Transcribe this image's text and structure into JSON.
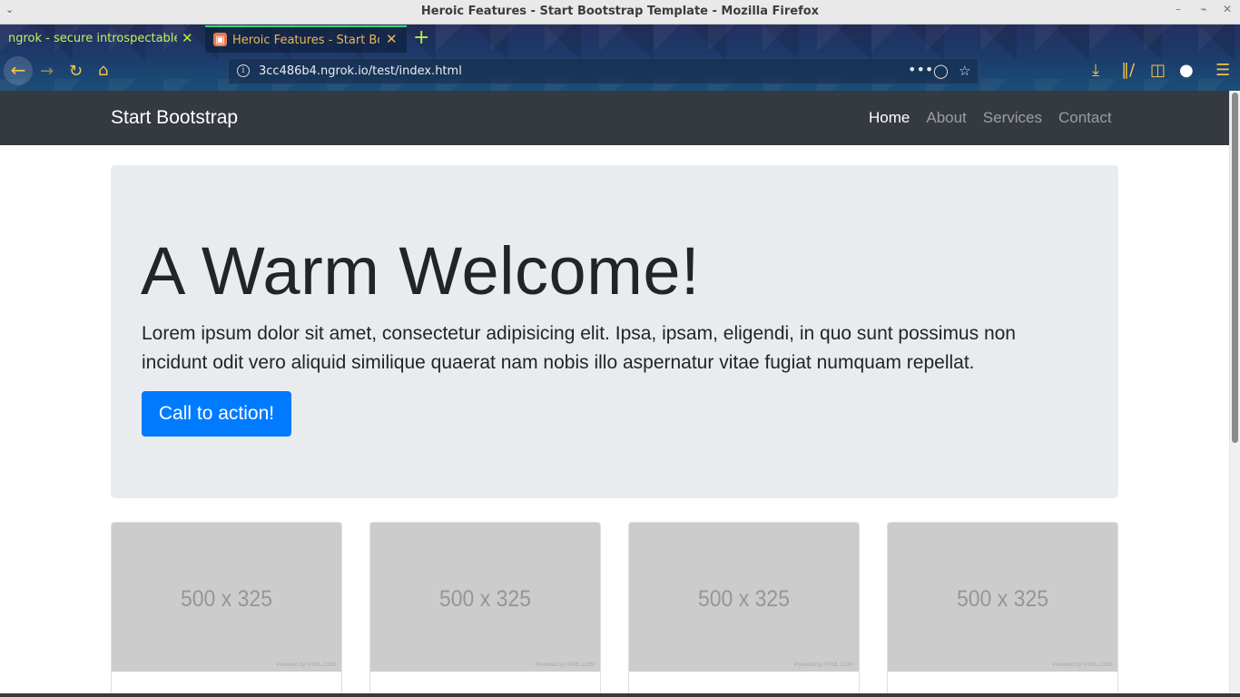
{
  "window": {
    "title": "Heroic Features - Start Bootstrap Template - Mozilla Firefox"
  },
  "tabs": [
    {
      "label": "ngrok - secure introspectable tunnels to localhost",
      "active": false
    },
    {
      "label": "Heroic Features - Start Bootstrap Template",
      "active": true
    }
  ],
  "toolbar": {
    "url": "3cc486b4.ngrok.io/test/index.html"
  },
  "site": {
    "brand": "Start Bootstrap",
    "nav": [
      {
        "label": "Home",
        "active": true
      },
      {
        "label": "About",
        "active": false
      },
      {
        "label": "Services",
        "active": false
      },
      {
        "label": "Contact",
        "active": false
      }
    ],
    "hero": {
      "heading": "A Warm Welcome!",
      "text": "Lorem ipsum dolor sit amet, consectetur adipisicing elit. Ipsa, ipsam, eligendi, in quo sunt possimus non incidunt odit vero aliquid similique quaerat nam nobis illo aspernatur vitae fugiat numquam repellat.",
      "button": "Call to action!"
    },
    "cards": [
      {
        "placeholder": "500 x 325",
        "powered": "Powered by HTML.COM"
      },
      {
        "placeholder": "500 x 325",
        "powered": "Powered by HTML.COM"
      },
      {
        "placeholder": "500 x 325",
        "powered": "Powered by HTML.COM"
      },
      {
        "placeholder": "500 x 325",
        "powered": "Powered by HTML.COM"
      }
    ]
  },
  "colors": {
    "navbar_bg": "#343a40",
    "jumbotron_bg": "#e9ecef",
    "primary": "#007bff",
    "placeholder_bg": "#cccccc"
  }
}
